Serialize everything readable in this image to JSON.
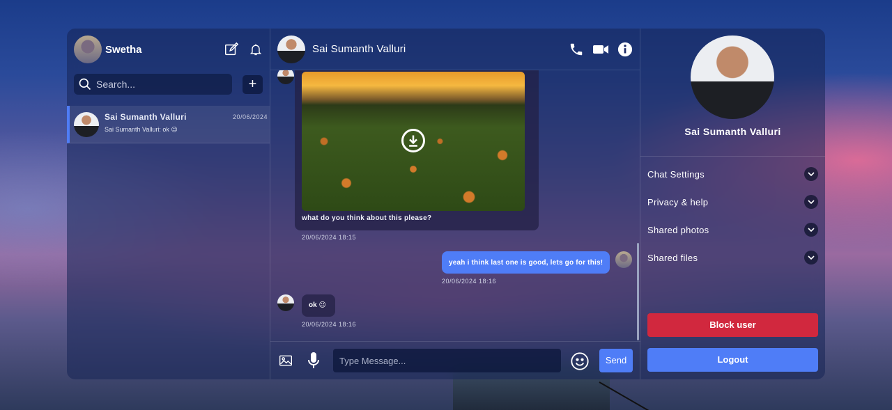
{
  "user": {
    "name": "Swetha"
  },
  "search": {
    "placeholder": "Search..."
  },
  "chat_list": [
    {
      "name": "Sai Sumanth Valluri",
      "preview": "Sai Sumanth Valluri: ok 😉",
      "date": "20/06/2024"
    }
  ],
  "chat": {
    "contact_name": "Sai Sumanth Valluri",
    "messages": [
      {
        "from": "contact",
        "type": "image",
        "caption": "what do you think about this please?",
        "time": "20/06/2024 18:15"
      },
      {
        "from": "me",
        "text": "yeah i think last one is good, lets go for this!",
        "time": "20/06/2024 18:16"
      },
      {
        "from": "contact",
        "text": "ok 😉",
        "time": "20/06/2024 18:16"
      }
    ],
    "input_placeholder": "Type Message...",
    "send_label": "Send"
  },
  "details": {
    "name": "Sai Sumanth Valluri",
    "options": [
      "Chat Settings",
      "Privacy & help",
      "Shared photos",
      "Shared files"
    ],
    "block_label": "Block user",
    "logout_label": "Logout"
  },
  "colors": {
    "accent": "#4f7df7",
    "danger": "#d1283e"
  }
}
